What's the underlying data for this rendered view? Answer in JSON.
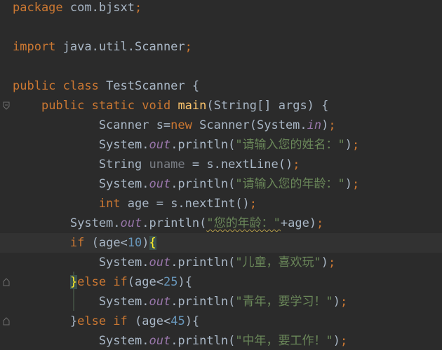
{
  "editor": {
    "language": "java",
    "colors": {
      "background": "#2b2b2b",
      "current_line": "#323232",
      "keyword": "#cc7832",
      "string": "#6a8759",
      "number": "#6897bb",
      "method_declaration": "#ffc66d",
      "static_field": "#9876aa",
      "plain": "#a9b7c6",
      "unused": "#7a7e85",
      "brace_match": "#ffef28"
    },
    "lines": [
      {
        "tokens": [
          {
            "t": "package",
            "c": "kw"
          },
          {
            "t": " com.bjsxt"
          },
          {
            "t": ";",
            "c": "kw"
          }
        ]
      },
      {
        "tokens": []
      },
      {
        "tokens": [
          {
            "t": "import",
            "c": "kw"
          },
          {
            "t": " java.util.Scanner"
          },
          {
            "t": ";",
            "c": "kw"
          }
        ]
      },
      {
        "tokens": []
      },
      {
        "tokens": [
          {
            "t": "public class",
            "c": "kw"
          },
          {
            "t": " TestScanner {"
          }
        ]
      },
      {
        "fold": "open",
        "tokens": [
          {
            "t": "    "
          },
          {
            "t": "public static void",
            "c": "kw"
          },
          {
            "t": " "
          },
          {
            "t": "main",
            "c": "fn"
          },
          {
            "t": "(String[] args) {"
          }
        ]
      },
      {
        "tokens": [
          {
            "t": "            Scanner s="
          },
          {
            "t": "new",
            "c": "kw"
          },
          {
            "t": " Scanner(System."
          },
          {
            "t": "in",
            "c": "field"
          },
          {
            "t": ")"
          },
          {
            "t": ";",
            "c": "kw"
          }
        ]
      },
      {
        "tokens": [
          {
            "t": "            System."
          },
          {
            "t": "out",
            "c": "field"
          },
          {
            "t": ".println("
          },
          {
            "t": "\"请输入您的姓名：\"",
            "c": "str"
          },
          {
            "t": ")"
          },
          {
            "t": ";",
            "c": "kw"
          }
        ]
      },
      {
        "tokens": [
          {
            "t": "            String "
          },
          {
            "t": "uname",
            "c": "unused"
          },
          {
            "t": " = s.nextLine()"
          },
          {
            "t": ";",
            "c": "kw"
          }
        ]
      },
      {
        "tokens": [
          {
            "t": "            System."
          },
          {
            "t": "out",
            "c": "field"
          },
          {
            "t": ".println("
          },
          {
            "t": "\"请输入您的年龄：\"",
            "c": "str"
          },
          {
            "t": ")"
          },
          {
            "t": ";",
            "c": "kw"
          }
        ]
      },
      {
        "tokens": [
          {
            "t": "            "
          },
          {
            "t": "int",
            "c": "kw"
          },
          {
            "t": " age = s.nextInt()"
          },
          {
            "t": ";",
            "c": "kw"
          }
        ]
      },
      {
        "tokens": [
          {
            "t": "        System."
          },
          {
            "t": "out",
            "c": "field"
          },
          {
            "t": ".println("
          },
          {
            "t": "\"您的年龄：\"",
            "c": "str",
            "u": true
          },
          {
            "t": "+age)"
          },
          {
            "t": ";",
            "c": "kw"
          }
        ]
      },
      {
        "fold": "open",
        "current": true,
        "tokens": [
          {
            "t": "        "
          },
          {
            "t": "if",
            "c": "kw"
          },
          {
            "t": " (age<"
          },
          {
            "t": "10",
            "c": "num"
          },
          {
            "t": ")"
          },
          {
            "t": "{",
            "c": "brace"
          }
        ]
      },
      {
        "tokens": [
          {
            "t": "            System."
          },
          {
            "t": "out",
            "c": "field"
          },
          {
            "t": ".println("
          },
          {
            "t": "\"儿童，喜欢玩\"",
            "c": "str"
          },
          {
            "t": ")"
          },
          {
            "t": ";",
            "c": "kw"
          }
        ]
      },
      {
        "fold": "close",
        "tokens": [
          {
            "t": "        "
          },
          {
            "t": "}",
            "c": "brace"
          },
          {
            "t": "else if",
            "c": "kw"
          },
          {
            "t": "(age<"
          },
          {
            "t": "25",
            "c": "num"
          },
          {
            "t": "){"
          }
        ]
      },
      {
        "tokens": [
          {
            "t": "            System."
          },
          {
            "t": "out",
            "c": "field"
          },
          {
            "t": ".println("
          },
          {
            "t": "\"青年，要学习！\"",
            "c": "str"
          },
          {
            "t": ")"
          },
          {
            "t": ";",
            "c": "kw"
          }
        ]
      },
      {
        "fold": "close",
        "tokens": [
          {
            "t": "        }"
          },
          {
            "t": "else if",
            "c": "kw"
          },
          {
            "t": " (age<"
          },
          {
            "t": "45",
            "c": "num"
          },
          {
            "t": "){"
          }
        ]
      },
      {
        "tokens": [
          {
            "t": "            System."
          },
          {
            "t": "out",
            "c": "field"
          },
          {
            "t": ".println("
          },
          {
            "t": "\"中年，要工作！\"",
            "c": "str"
          },
          {
            "t": ")"
          },
          {
            "t": ";",
            "c": "kw"
          }
        ]
      }
    ]
  }
}
